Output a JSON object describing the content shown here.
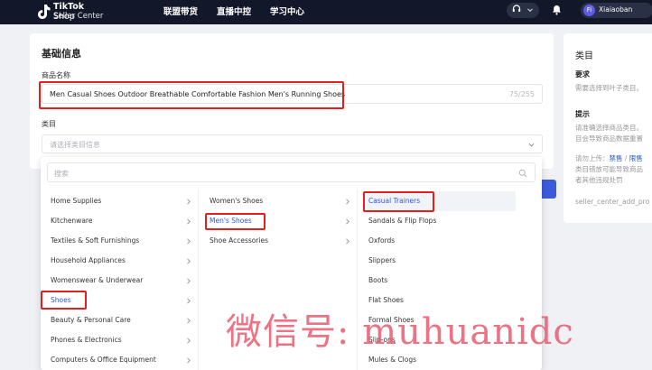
{
  "nav": {
    "logo_line1": "TikTok",
    "logo_line1_suffix": "Shop",
    "logo_line2": "Seller Center",
    "items": [
      {
        "label": "联盟带货"
      },
      {
        "label": "直播中控"
      },
      {
        "label": "学习中心"
      }
    ],
    "user_initial": "Fi",
    "user_name": "Xiaiaoban"
  },
  "form": {
    "section_title": "基础信息",
    "name_label": "商品名称",
    "name_value": "Men Casual Shoes Outdoor Breathable Comfortable Fashion Men's Running Shoes",
    "name_count": "75/255",
    "category_label": "类目",
    "category_placeholder": "请选择类目信息"
  },
  "right_panel": {
    "title": "类目",
    "req_heading": "要求",
    "req_text": "需要选择到叶子类目。",
    "tip_heading": "提示",
    "tip_line1": "请准确选择商品类目。",
    "tip_line2": "目会导致商品数据重置",
    "tip_line3_prefix": "请勿上传：",
    "tip_link1": "禁售",
    "tip_sep": " / ",
    "tip_link2": "限售",
    "tip_line4": "类目错放可能导致商品",
    "tip_line5": "者其他违规处罚",
    "footer": "seller_center_add_pro"
  },
  "dropdown": {
    "search_placeholder": "搜索",
    "col1": [
      {
        "label": "Home Supplies"
      },
      {
        "label": "Kitchenware"
      },
      {
        "label": "Textiles & Soft Furnishings"
      },
      {
        "label": "Household Appliances"
      },
      {
        "label": "Womenswear & Underwear"
      },
      {
        "label": "Shoes"
      },
      {
        "label": "Beauty & Personal Care"
      },
      {
        "label": "Phones & Electronics"
      },
      {
        "label": "Computers & Office Equipment"
      }
    ],
    "col2": [
      {
        "label": "Women's Shoes"
      },
      {
        "label": "Men's Shoes"
      },
      {
        "label": "Shoe Accessories"
      }
    ],
    "col3": [
      {
        "label": "Casual Trainers"
      },
      {
        "label": "Sandals & Flip Flops"
      },
      {
        "label": "Oxfords"
      },
      {
        "label": "Slippers"
      },
      {
        "label": "Boots"
      },
      {
        "label": "Flat Shoes"
      },
      {
        "label": "Formal Shoes"
      },
      {
        "label": "Slip-ons"
      },
      {
        "label": "Mules & Clogs"
      }
    ]
  },
  "watermark": "微信号: muhuanidc",
  "colors": {
    "nav_bg": "#121829",
    "highlight": "#e0201d",
    "accent_blue": "#2f54eb",
    "watermark": "#e95a6e"
  }
}
